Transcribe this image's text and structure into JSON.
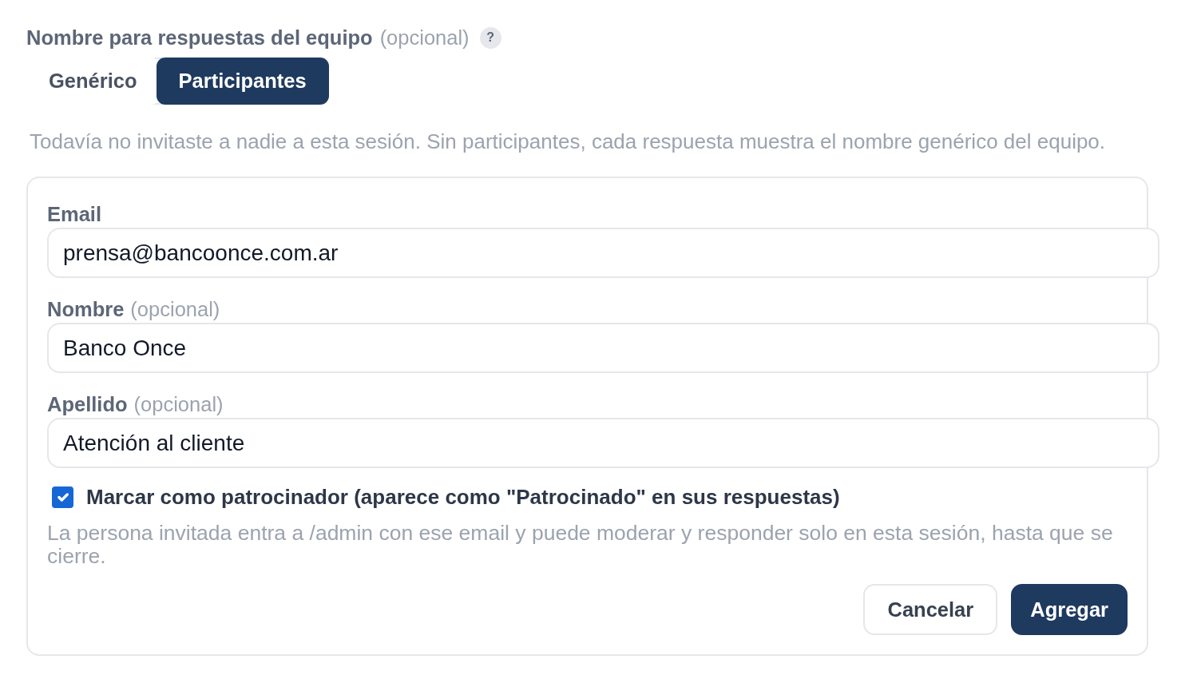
{
  "team_name": {
    "label": "Nombre para respuestas del equipo",
    "optional_note": "(opcional)",
    "help": "?"
  },
  "mode_tabs": [
    {
      "label": "Genérico",
      "selected": false
    },
    {
      "label": "Participantes",
      "selected": true
    }
  ],
  "description": "Todavía no invitaste a nadie a esta sesión. Sin participantes, cada respuesta muestra el nombre genérico del equipo.",
  "invite_form": {
    "fields": [
      {
        "label": "Email",
        "value": "prensa@bancoonce.com.ar"
      },
      {
        "label": "Nombre",
        "optional_note": "(opcional)",
        "value": "Banco Once"
      },
      {
        "label": "Apellido",
        "optional_note": "(opcional)",
        "value": "Atención al cliente"
      }
    ],
    "sponsor_checkbox": {
      "label": "Marcar como patrocinador (aparece como \"Patrocinado\" en sus respuestas)",
      "checked": true
    },
    "hint": "La persona invitada entra a /admin con ese email y puede moderar y responder solo en esta sesión, hasta que se cierre.",
    "buttons": [
      {
        "label": "Cancelar",
        "kind": "secondary"
      },
      {
        "label": "Agregar",
        "kind": "primary"
      }
    ]
  }
}
